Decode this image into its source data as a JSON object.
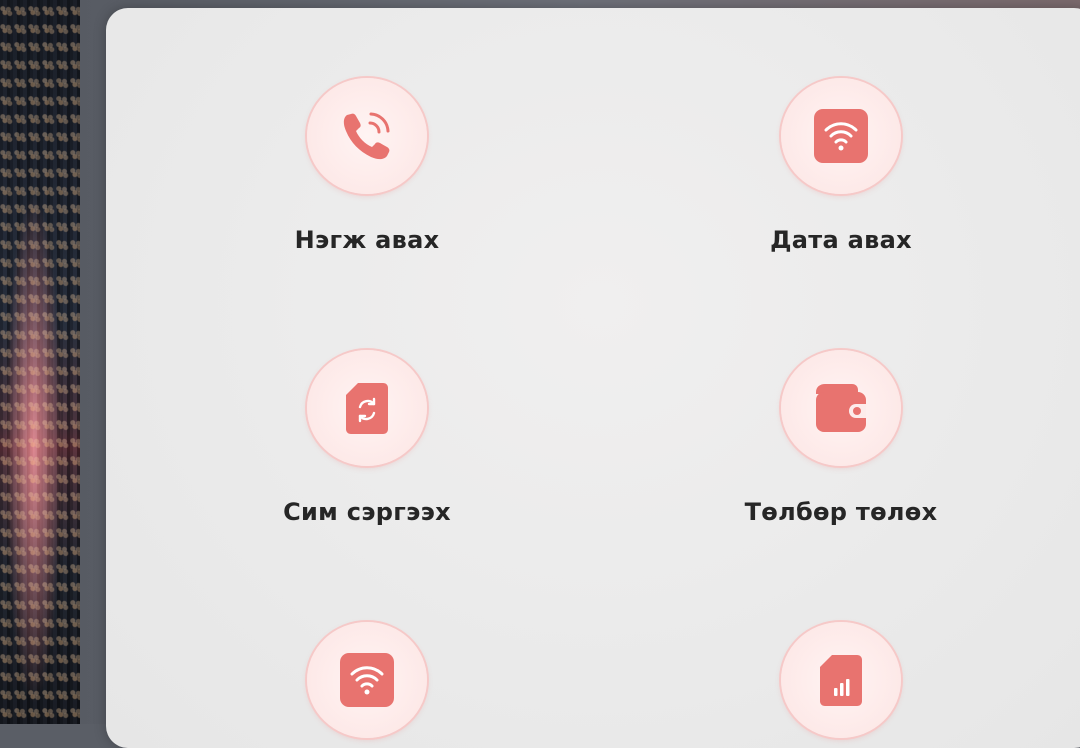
{
  "colors": {
    "accent": "#e8736f",
    "label": "#262626",
    "panel": "#ececec"
  },
  "services": [
    {
      "label": "Нэгж авах",
      "icon": "phone-call-icon"
    },
    {
      "label": "Дата авах",
      "icon": "wifi-icon"
    },
    {
      "label": "Сим сэргээх",
      "icon": "sim-refresh-icon"
    },
    {
      "label": "Төлбөр төлөх",
      "icon": "wallet-icon"
    },
    {
      "label": "",
      "icon": "wifi-icon"
    },
    {
      "label": "",
      "icon": "sim-signal-icon"
    }
  ]
}
